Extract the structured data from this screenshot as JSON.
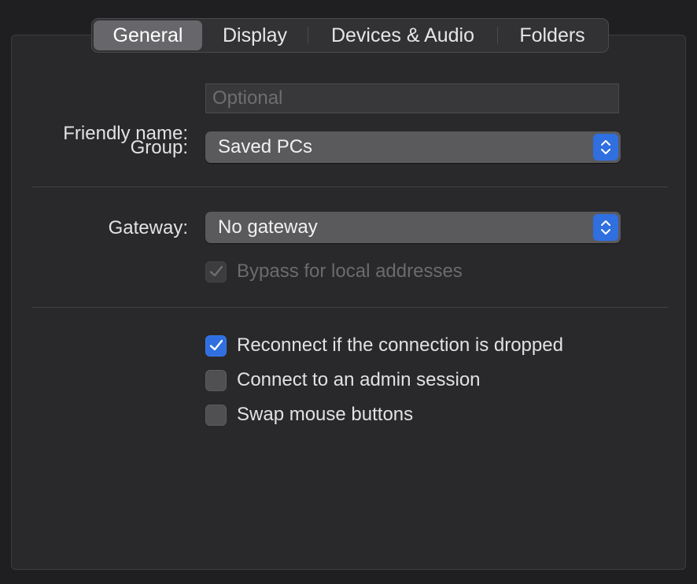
{
  "tabs": [
    {
      "label": "General",
      "active": true
    },
    {
      "label": "Display",
      "active": false
    },
    {
      "label": "Devices & Audio",
      "active": false
    },
    {
      "label": "Folders",
      "active": false
    }
  ],
  "friendly_name": {
    "label": "Friendly name:",
    "value": "",
    "placeholder": "Optional"
  },
  "group": {
    "label": "Group:",
    "selected": "Saved PCs"
  },
  "gateway": {
    "label": "Gateway:",
    "selected": "No gateway",
    "bypass": {
      "label": "Bypass for local addresses",
      "checked": true,
      "enabled": false
    }
  },
  "options": [
    {
      "label": "Reconnect if the connection is dropped",
      "checked": true
    },
    {
      "label": "Connect to an admin session",
      "checked": false
    },
    {
      "label": "Swap mouse buttons",
      "checked": false
    }
  ],
  "colors": {
    "accent": "#2f6fe0",
    "panel": "#29292b",
    "window": "#1f1f21"
  },
  "icons": {
    "popup_arrows": "chevron-up-down-icon",
    "check": "checkmark-icon"
  }
}
